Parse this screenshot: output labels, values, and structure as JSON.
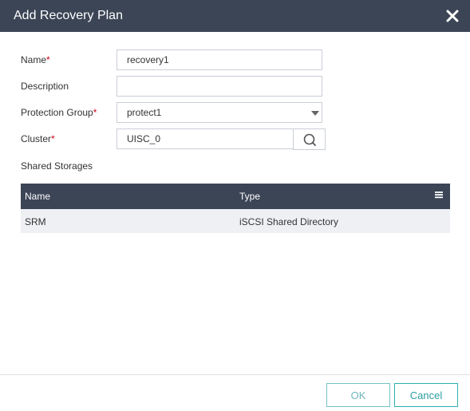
{
  "dialog": {
    "title": "Add Recovery Plan"
  },
  "form": {
    "name_label": "Name",
    "name_value": "recovery1",
    "description_label": "Description",
    "description_value": "",
    "protection_group_label": "Protection Group",
    "protection_group_value": "protect1",
    "cluster_label": "Cluster",
    "cluster_value": "UISC_0",
    "required_marker": "*"
  },
  "shared_storages": {
    "label": "Shared Storages",
    "columns": [
      "Name",
      "Type"
    ],
    "rows": [
      {
        "name": "SRM",
        "type": "iSCSI Shared Directory"
      }
    ]
  },
  "footer": {
    "ok_label": "OK",
    "cancel_label": "Cancel"
  },
  "colors": {
    "header_bg": "#3b4556",
    "accent": "#2eb0b2",
    "required": "#d0021b",
    "row_bg": "#eef0f3"
  },
  "icons": {
    "close": "close-icon",
    "dropdown": "caret-down-icon",
    "search": "search-icon",
    "column_menu": "menu-icon"
  }
}
